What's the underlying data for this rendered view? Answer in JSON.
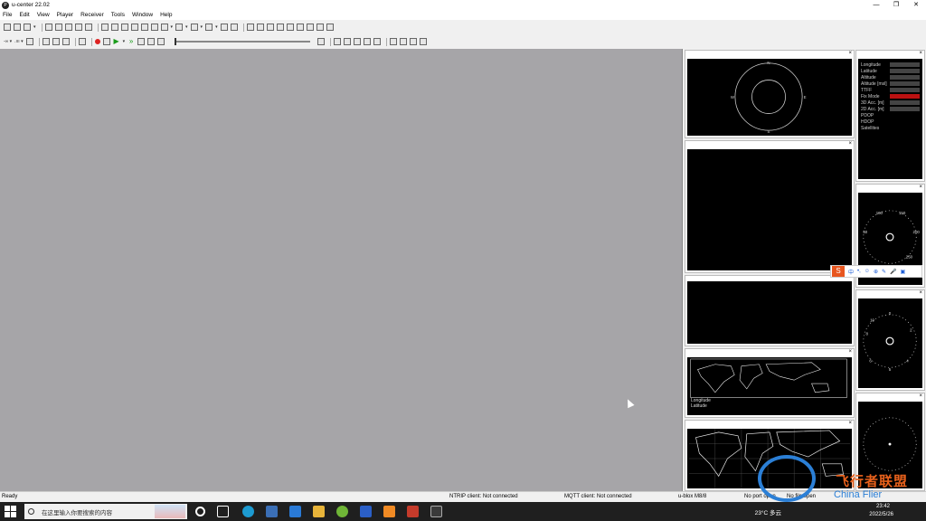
{
  "window": {
    "title": "u-center 22.02",
    "controls": [
      "—",
      "❐",
      "✕"
    ]
  },
  "menu": [
    "File",
    "Edit",
    "View",
    "Player",
    "Receiver",
    "Tools",
    "Window",
    "Help"
  ],
  "toolbar2": {
    "baud_label": "-∞ ▾",
    "rate_label": ".ııı ▾"
  },
  "gnss_info": {
    "labels": [
      "Longitude",
      "Latitude",
      "Altitude",
      "Altitude [msl]",
      "TTFF",
      "Fix Mode",
      "3D Acc. [m]",
      "2D Acc. [m]",
      "PDOP",
      "HDOP",
      "Satellites"
    ]
  },
  "compass_left": {
    "labels": [
      "N",
      "E",
      "S",
      "W"
    ]
  },
  "speed_gauge": {
    "labels": [
      "100",
      "150",
      "50",
      "200",
      "250"
    ]
  },
  "clock_gauge": {
    "labels": [
      "0",
      "2",
      "4",
      "5",
      "6",
      "8",
      "10"
    ]
  },
  "world_map_small": {
    "longitude_label": "Longitude",
    "latitude_label": "Latitude"
  },
  "ime_bar": {
    "logo": "S",
    "items": [
      "中",
      "•,",
      "☺",
      "⊕",
      "✎",
      "🎤",
      "▣"
    ]
  },
  "statusbar": {
    "ready": "Ready",
    "ntrip": "NTRIP client: Not connected",
    "mqtt": "MQTT client: Not connected",
    "receiver": "u-blox M8/8",
    "port": "No port open",
    "file": "No file open"
  },
  "watermark": {
    "cn": "飞行者联盟",
    "en": "China Flier"
  },
  "taskbar": {
    "search_placeholder": "在这里输入你要搜索的内容",
    "weather": "23°C 多云",
    "time": "23:42",
    "date": "2022/5/26"
  },
  "colors": {
    "workspace": "#a6a5a8",
    "screen": "#000000",
    "fix_mode": "#b11111",
    "watermark_orange": "#e8611c",
    "watermark_blue": "#2b7fd6"
  }
}
